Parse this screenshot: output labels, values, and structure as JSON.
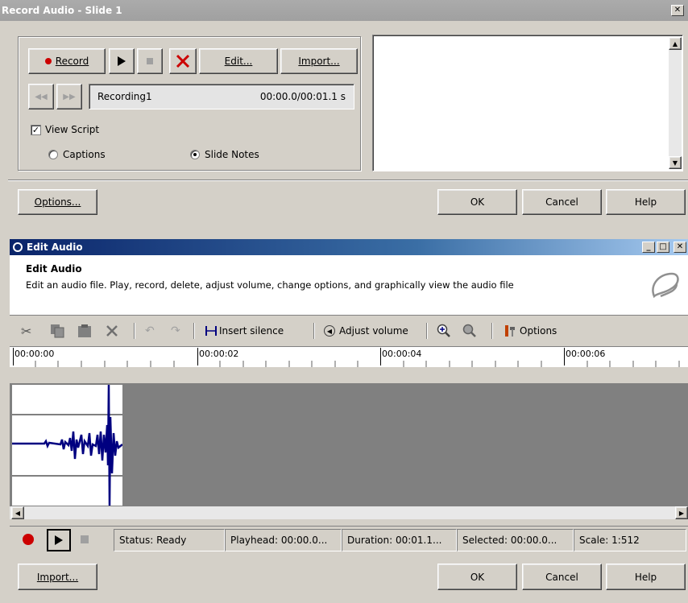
{
  "record_dialog": {
    "title": "Record Audio - Slide 1",
    "record_label": "Record",
    "edit_label": "Edit...",
    "import_label": "Import...",
    "recording_name": "Recording1",
    "recording_time": "00:00.0/00:01.1 s",
    "view_script_label": "View Script",
    "view_script_checked": true,
    "captions_label": "Captions",
    "slide_notes_label": "Slide Notes",
    "selected_radio": "slide_notes",
    "options_label": "Options...",
    "ok_label": "OK",
    "cancel_label": "Cancel",
    "help_label": "Help",
    "accent_red": "#cc0000"
  },
  "edit_dialog": {
    "title": "Edit Audio",
    "header_title": "Edit Audio",
    "header_desc": "Edit an audio file. Play, record, delete, adjust volume, change options, and graphically view the audio file",
    "toolbar": {
      "cut_icon": "scissors-icon",
      "copy_icon": "copy-icon",
      "paste_icon": "paste-icon",
      "delete_icon": "x-icon",
      "undo_icon": "undo-icon",
      "redo_icon": "redo-icon",
      "insert_silence_label": "Insert silence",
      "adjust_volume_label": "Adjust volume",
      "zoom_in_icon": "zoom-in-icon",
      "zoom_out_icon": "zoom-out-icon",
      "options_label": "Options"
    },
    "ruler": [
      "00:00:00",
      "00:00:02",
      "00:00:04",
      "00:00:06"
    ],
    "status": {
      "status": "Status: Ready",
      "playhead": "Playhead: 00:00.0...",
      "duration": "Duration: 00:01.1...",
      "selected": "Selected: 00:00.0...",
      "scale": "Scale: 1:512"
    },
    "import_label": "Import...",
    "ok_label": "OK",
    "cancel_label": "Cancel",
    "help_label": "Help",
    "waveform_color": "#000080",
    "title_gradient_start": "#0a246a"
  }
}
